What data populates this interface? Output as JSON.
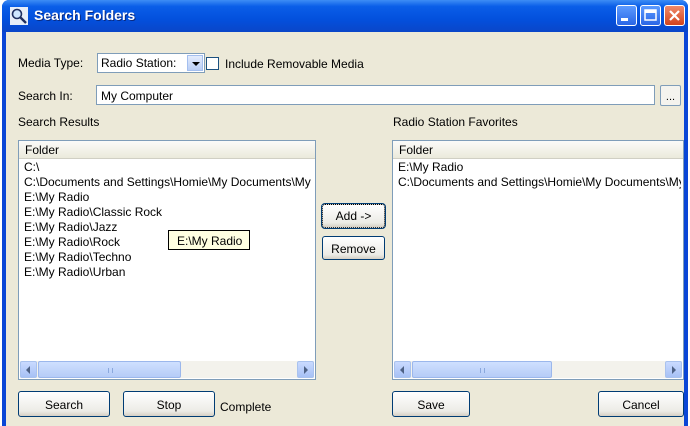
{
  "window": {
    "title": "Search Folders",
    "accent": "#0a46d6",
    "icons": [
      "search-folder-icon",
      "minimize-icon",
      "maximize-icon",
      "close-icon"
    ]
  },
  "media_type": {
    "label": "Media Type:",
    "value": "Radio Station:"
  },
  "removable": {
    "label": "Include Removable Media",
    "checked": false
  },
  "search_in": {
    "label": "Search In:",
    "value": "My Computer",
    "browse_label": "..."
  },
  "results": {
    "label": "Search Results",
    "column": "Folder",
    "rows": [
      "C:\\",
      "C:\\Documents and Settings\\Homie\\My Documents\\My",
      "E:\\My Radio",
      "E:\\My Radio\\Classic Rock",
      "E:\\My Radio\\Jazz",
      "E:\\My Radio\\Rock",
      "E:\\My Radio\\Techno",
      "E:\\My Radio\\Urban"
    ],
    "scroll_thumb_fraction": 0.55
  },
  "tooltip": "E:\\My Radio",
  "favorites": {
    "label": "Radio Station Favorites",
    "column": "Folder",
    "rows": [
      "E:\\My Radio",
      "C:\\Documents and Settings\\Homie\\My Documents\\My"
    ],
    "scroll_thumb_fraction": 0.55
  },
  "buttons": {
    "add": "Add ->",
    "remove": "Remove",
    "search": "Search",
    "stop": "Stop",
    "save": "Save",
    "cancel": "Cancel"
  },
  "status": "Complete"
}
